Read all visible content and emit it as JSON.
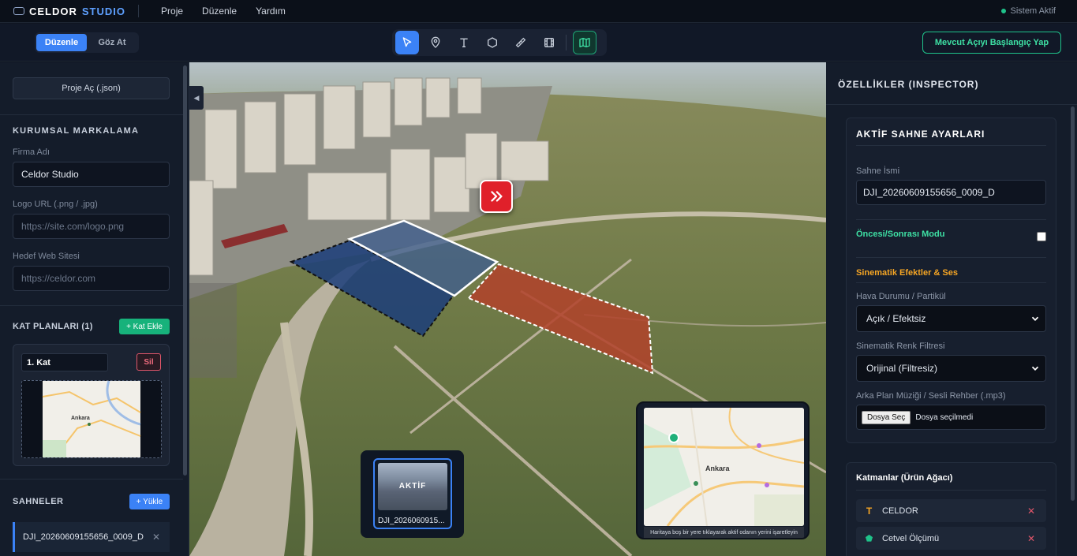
{
  "brand": {
    "name": "CELDOR",
    "suffix": "STUDIO"
  },
  "menu": [
    "Proje",
    "Düzenle",
    "Yardım"
  ],
  "status": {
    "text": "Sistem Aktif",
    "color": "#1fc28a"
  },
  "toolbar": {
    "modes": [
      {
        "label": "Düzenle",
        "active": true
      },
      {
        "label": "Göz At",
        "active": false
      }
    ],
    "tools": [
      "cursor-icon",
      "map-pin-icon",
      "text-icon",
      "polygon-icon",
      "ruler-icon",
      "film-icon",
      "map-icon"
    ],
    "start_view_label": "Mevcut Açıyı Başlangıç Yap"
  },
  "left": {
    "open_project": "Proje Aç (.json)",
    "branding_title": "KURUMSAL MARKALAMA",
    "company_label": "Firma Adı",
    "company_value": "Celdor Studio",
    "logo_label": "Logo URL (.png / .jpg)",
    "logo_placeholder": "https://site.com/logo.png",
    "website_label": "Hedef Web Sitesi",
    "website_placeholder": "https://celdor.com",
    "floors_title": "KAT PLANLARI (1)",
    "add_floor": "+ Kat Ekle",
    "floor_name": "1. Kat",
    "delete_label": "Sil",
    "floor_map_city": "Ankara",
    "scenes_title": "SAHNELER",
    "upload_label": "+ Yükle",
    "scenes": [
      {
        "name": "DJI_20260609155656_0009_D"
      }
    ]
  },
  "viewport": {
    "active_tag": "AKTİF",
    "active_scene_caption": "DJI_2026060915...",
    "minimap_city": "Ankara",
    "minimap_hint": "Haritaya boş bir yere tıklayarak aktif odanın yerini işaretleyin"
  },
  "inspector": {
    "title": "ÖZELLİKLER (INSPECTOR)",
    "scene_settings_title": "AKTİF SAHNE AYARLARI",
    "scene_name_label": "Sahne İsmi",
    "scene_name_value": "DJI_20260609155656_0009_D",
    "before_after_label": "Öncesi/Sonrası Modu",
    "before_after_checked": false,
    "effects_title": "Sinematik Efektler & Ses",
    "weather_label": "Hava Durumu / Partikül",
    "weather_value": "Açık / Efektsiz",
    "filter_label": "Sinematik Renk Filtresi",
    "filter_value": "Orijinal (Filtresiz)",
    "audio_label": "Arka Plan Müziği / Sesli Rehber (.mp3)",
    "file_button": "Dosya Seç",
    "file_status": "Dosya seçilmedi",
    "layers_title": "Katmanlar (Ürün Ağacı)",
    "layers": [
      {
        "icon": "text-icon",
        "label": "CELDOR"
      },
      {
        "icon": "pentagon-icon",
        "label": "Cetvel Ölçümü"
      }
    ]
  },
  "colors": {
    "accent": "#3b82f6",
    "success": "#1fc28a",
    "danger": "#e0566a",
    "effects_title": "#f5a524",
    "before_after": "#3ee0a4"
  }
}
